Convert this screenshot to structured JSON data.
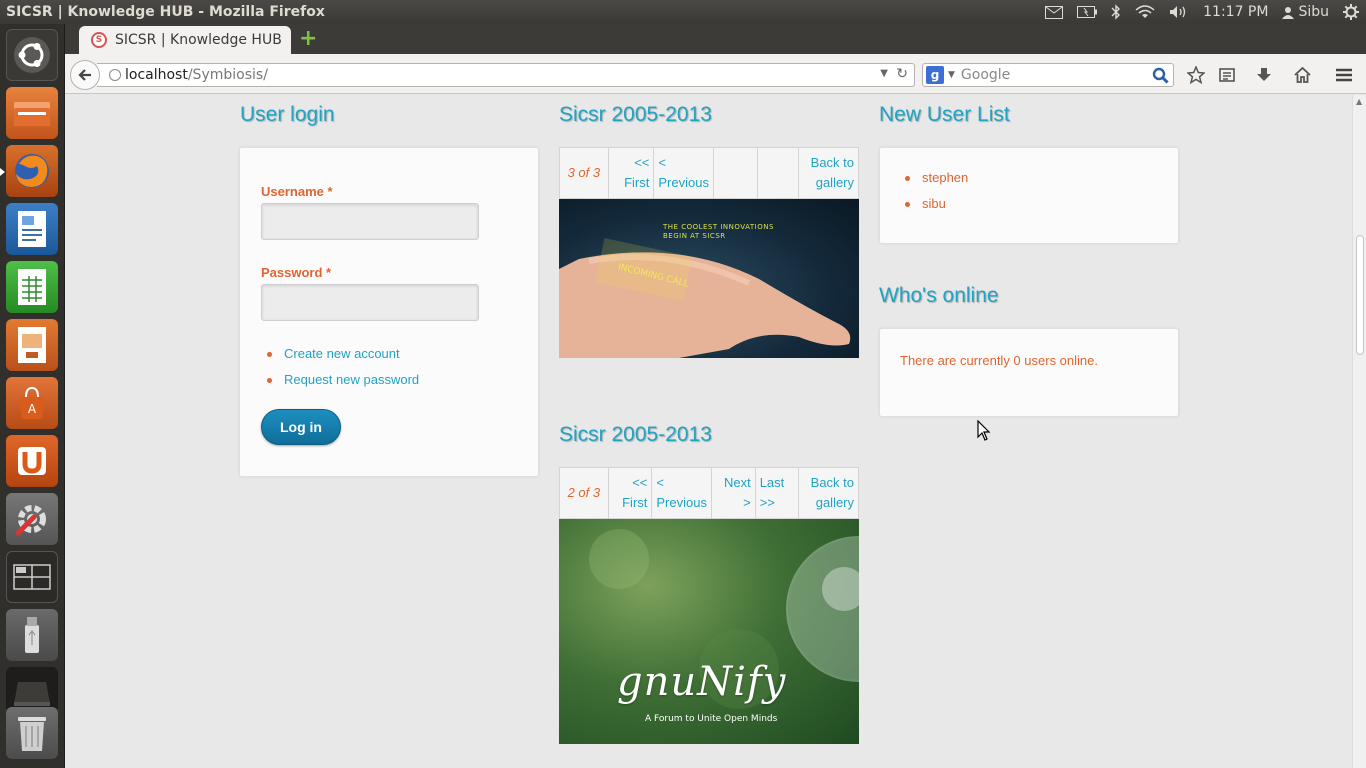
{
  "os": {
    "window_title": "SICSR | Knowledge HUB - Mozilla Firefox",
    "clock": "11:17 PM",
    "user": "Sibu",
    "launcher_items": [
      "ubuntu-dash",
      "files",
      "firefox",
      "writer",
      "calc",
      "impress",
      "software-center",
      "ubuntu-one",
      "system-settings",
      "workspace-switcher",
      "usb-drive",
      "removable-drive",
      "trash"
    ]
  },
  "browser": {
    "tab_title": "SICSR | Knowledge HUB",
    "url_host": "localhost",
    "url_path": "/Symbiosis/",
    "search_placeholder": "Google"
  },
  "login": {
    "title": "User login",
    "username_label": "Username",
    "password_label": "Password",
    "required_mark": "*",
    "links": [
      "Create new account",
      "Request new password"
    ],
    "submit": "Log in"
  },
  "gallery1": {
    "title": "Sicsr 2005-2013",
    "count": "3 of 3",
    "first": "<< First",
    "previous": "< Previous",
    "next": "",
    "last": "",
    "back": "Back to gallery",
    "image_caption_1": "THE COOLEST INNOVATIONS",
    "image_caption_2": "BEGIN AT SICSR",
    "wrist_text_1": "INCOMING CALL"
  },
  "gallery2": {
    "title": "Sicsr 2005-2013",
    "count": "2 of 3",
    "first": "<< First",
    "previous": "< Previous",
    "next": "Next >",
    "last": "Last >>",
    "back": "Back to gallery",
    "logo_text": "gnuNify",
    "logo_tagline": "A Forum to Unite Open Minds"
  },
  "new_users": {
    "title": "New User List",
    "users": [
      "stephen",
      "sibu"
    ]
  },
  "online": {
    "title": "Who's online",
    "message": "There are currently 0 users online."
  }
}
